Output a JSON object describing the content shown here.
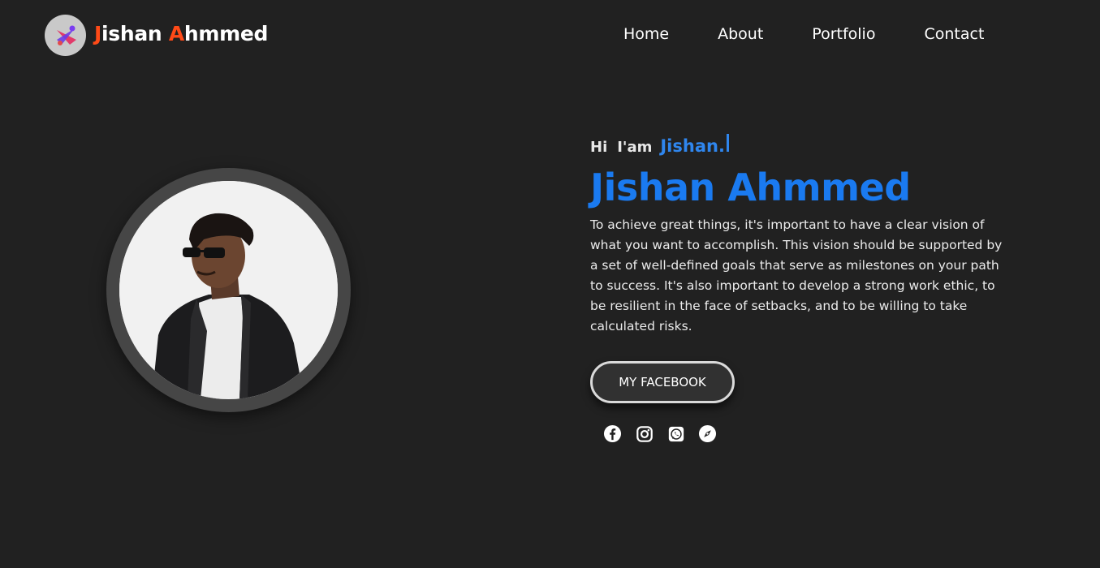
{
  "header": {
    "brand": {
      "first_initial": "J",
      "first_rest": "ishan ",
      "last_initial": "A",
      "last_rest": "hmmed"
    },
    "logo_icon": "code-logo-icon",
    "nav": [
      {
        "label": "Home"
      },
      {
        "label": "About"
      },
      {
        "label": "Portfolio"
      },
      {
        "label": "Contact"
      }
    ]
  },
  "hero": {
    "greeting_hi": "Hi",
    "greeting_iam": "I'am",
    "greeting_typed": "Jishan.",
    "name": "Jishan Ahmmed",
    "bio": "To achieve great things, it's important to have a clear vision of what you want to accomplish. This vision should be supported by a set of well-defined goals that serve as milestones on your path to success. It's also important to develop a strong work ethic, to be resilient in the face of setbacks, and to be willing to take calculated risks.",
    "button_label": "MY FACEBOOK",
    "socials": [
      "facebook-icon",
      "instagram-icon",
      "whatsapp-icon",
      "compass-icon"
    ]
  },
  "colors": {
    "background": "#212121",
    "brand_accent": "#ff4a17",
    "name_blue": "#1a7af0",
    "typed_blue": "#2f86ee"
  }
}
